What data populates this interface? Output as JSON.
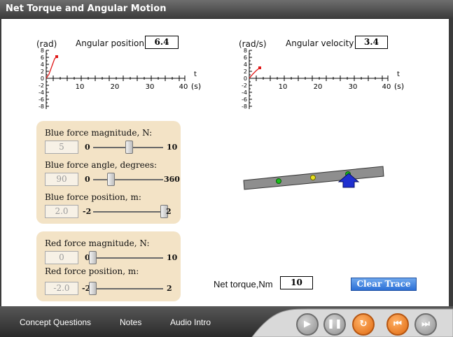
{
  "title": "Net Torque and Angular Motion",
  "graph1": {
    "unit": "(rad)",
    "label": "Angular position",
    "value": "6.4",
    "x_ticks": [
      "10",
      "20",
      "30",
      "40"
    ],
    "x_axis": "t",
    "x_unit": "(s)",
    "y_ticks": [
      "8",
      "6",
      "4",
      "2",
      "0",
      "-2",
      "-4",
      "-6",
      "-8"
    ]
  },
  "graph2": {
    "unit": "(rad/s)",
    "label": "Angular velocity",
    "value": "3.4",
    "x_ticks": [
      "10",
      "20",
      "30",
      "40"
    ],
    "x_axis": "t",
    "x_unit": "(s)",
    "y_ticks": [
      "8",
      "6",
      "4",
      "2",
      "0",
      "-2",
      "-4",
      "-6",
      "-8"
    ]
  },
  "blue": {
    "mag_label": "Blue force magnitude, N:",
    "mag_value": "5",
    "mag_min": "0",
    "mag_max": "10",
    "angle_label": "Blue force angle, degrees:",
    "angle_value": "90",
    "angle_min": "0",
    "angle_max": "360",
    "pos_label": "Blue force position, m:",
    "pos_value": "2.0",
    "pos_min": "-2",
    "pos_max": "2"
  },
  "red": {
    "mag_label": "Red force magnitude, N:",
    "mag_value": "0",
    "mag_min": "0",
    "mag_max": "10",
    "pos_label": "Red force position, m:",
    "pos_value": "-2.0",
    "pos_min": "-2",
    "pos_max": "2"
  },
  "torque": {
    "label": "Net torque,Nm",
    "value": "10"
  },
  "clear_label": "Clear Trace",
  "nav": {
    "concept": "Concept Questions",
    "notes": "Notes",
    "audio": "Audio Intro"
  },
  "colors": {
    "accent_orange": "#e06a10",
    "panel": "#f3e3c6",
    "blue_force": "#1f2fd0",
    "trace_red": "#e01818"
  }
}
